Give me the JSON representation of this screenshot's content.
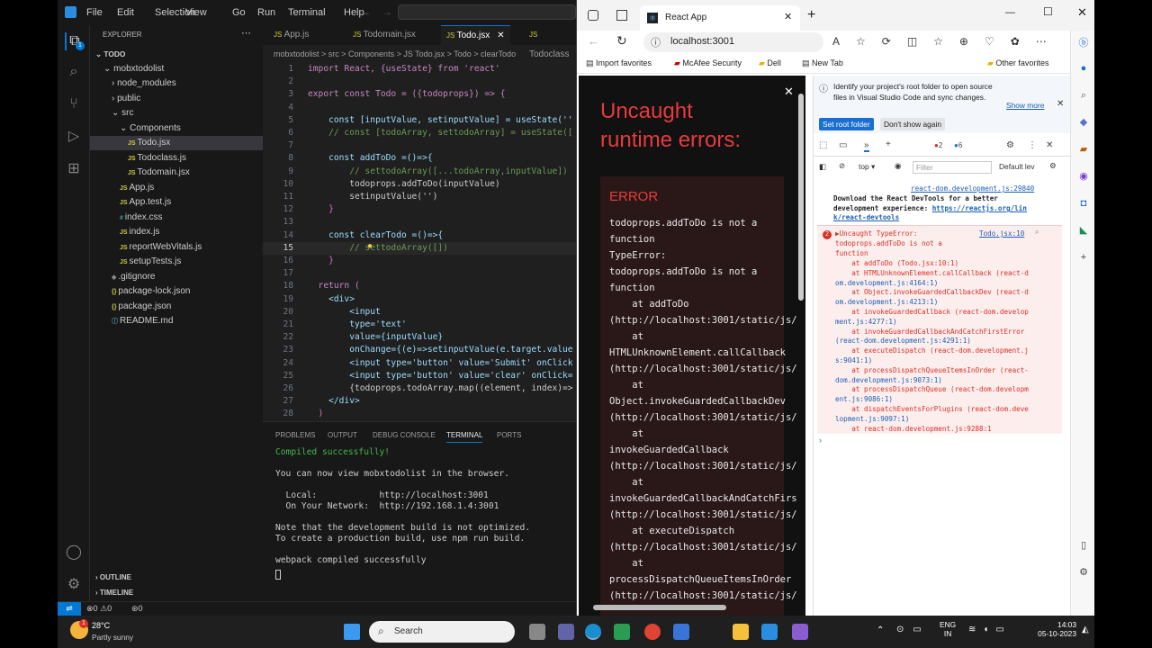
{
  "vscode": {
    "menu": [
      "File",
      "Edit",
      "Selection",
      "View",
      "Go",
      "Run",
      "Terminal",
      "Help"
    ],
    "explorer_title": "EXPLORER",
    "tree": [
      {
        "label": "TODO",
        "indent": 0,
        "type": "root"
      },
      {
        "label": "mobxtodolist",
        "indent": 1,
        "type": "folder"
      },
      {
        "label": "node_modules",
        "indent": 2,
        "type": "folder-closed"
      },
      {
        "label": "public",
        "indent": 2,
        "type": "folder-closed"
      },
      {
        "label": "src",
        "indent": 2,
        "type": "folder"
      },
      {
        "label": "Components",
        "indent": 3,
        "type": "folder"
      },
      {
        "label": "Todo.jsx",
        "indent": 4,
        "type": "js",
        "active": true
      },
      {
        "label": "Todoclass.js",
        "indent": 4,
        "type": "js"
      },
      {
        "label": "Todomain.jsx",
        "indent": 4,
        "type": "js"
      },
      {
        "label": "App.js",
        "indent": 3,
        "type": "js"
      },
      {
        "label": "App.test.js",
        "indent": 3,
        "type": "js"
      },
      {
        "label": "index.css",
        "indent": 3,
        "type": "css"
      },
      {
        "label": "index.js",
        "indent": 3,
        "type": "js"
      },
      {
        "label": "reportWebVitals.js",
        "indent": 3,
        "type": "js"
      },
      {
        "label": "setupTests.js",
        "indent": 3,
        "type": "js"
      },
      {
        "label": ".gitignore",
        "indent": 2,
        "type": "git"
      },
      {
        "label": "package-lock.json",
        "indent": 2,
        "type": "json"
      },
      {
        "label": "package.json",
        "indent": 2,
        "type": "json"
      },
      {
        "label": "README.md",
        "indent": 2,
        "type": "md"
      }
    ],
    "outline": "OUTLINE",
    "timeline": "TIMELINE",
    "tabs": [
      "App.js",
      "Todomain.jsx",
      "Todo.jsx",
      "Todoclass"
    ],
    "breadcrumb": "mobxtodolist > src > Components > JS Todo.jsx > Todo > clearTodo",
    "code": [
      {
        "n": "1",
        "t": "import React, {useState} from 'react'"
      },
      {
        "n": "2",
        "t": ""
      },
      {
        "n": "3",
        "t": "export const Todo = ({todoprops}) => {"
      },
      {
        "n": "4",
        "t": ""
      },
      {
        "n": "5",
        "t": "    const [inputValue, setinputValue] = useState(''"
      },
      {
        "n": "6",
        "t": "    // const [todoArray, settodoArray] = useState(["
      },
      {
        "n": "7",
        "t": ""
      },
      {
        "n": "8",
        "t": "    const addToDo =()=>{"
      },
      {
        "n": "9",
        "t": "        // settodoArray([...todoArray,inputValue])"
      },
      {
        "n": "10",
        "t": "        todoprops.addToDo(inputValue)"
      },
      {
        "n": "11",
        "t": "        setinputValue('')"
      },
      {
        "n": "12",
        "t": "    }"
      },
      {
        "n": "13",
        "t": ""
      },
      {
        "n": "14",
        "t": "    const clearTodo =()=>{"
      },
      {
        "n": "15",
        "t": "        // settodoArray([])"
      },
      {
        "n": "16",
        "t": "    }"
      },
      {
        "n": "17",
        "t": ""
      },
      {
        "n": "18",
        "t": "  return ("
      },
      {
        "n": "19",
        "t": "    <div>"
      },
      {
        "n": "20",
        "t": "        <input"
      },
      {
        "n": "21",
        "t": "        type='text'"
      },
      {
        "n": "22",
        "t": "        value={inputValue}"
      },
      {
        "n": "23",
        "t": "        onChange={(e)=>setinputValue(e.target.value"
      },
      {
        "n": "24",
        "t": "        <input type='button' value='Submit' onClick"
      },
      {
        "n": "25",
        "t": "        <input type='button' value='clear' onClick="
      },
      {
        "n": "26",
        "t": "        {todoprops.todoArray.map((element, index)=>"
      },
      {
        "n": "27",
        "t": "    </div>"
      },
      {
        "n": "28",
        "t": "  )"
      }
    ],
    "panel_tabs": [
      "PROBLEMS",
      "OUTPUT",
      "DEBUG CONSOLE",
      "TERMINAL",
      "PORTS"
    ],
    "terminal": [
      "Compiled successfully!",
      "",
      "You can now view mobxtodolist in the browser.",
      "",
      "  Local:            http://localhost:3001",
      "  On Your Network:  http://192.168.1.4:3001",
      "",
      "Note that the development build is not optimized.",
      "To create a production build, use npm run build.",
      "",
      "webpack compiled successfully"
    ],
    "status": {
      "errors": "0",
      "warnings": "0",
      "ports": "0"
    }
  },
  "browser": {
    "tab_title": "React App",
    "url": "localhost:3001",
    "favorites": [
      "Import favorites",
      "McAfee Security",
      "Dell",
      "New Tab",
      "Other favorites"
    ],
    "overlay": {
      "title_line1": "Uncaught",
      "title_line2": "runtime errors:",
      "error_label": "ERROR",
      "lines": [
        "todoprops.addToDo is not a",
        "function",
        "TypeError:",
        "todoprops.addToDo is not a",
        "function",
        "    at addToDo",
        "(http://localhost:3001/static/js/",
        "    at",
        "HTMLUnknownElement.callCallback",
        "(http://localhost:3001/static/js/",
        "    at",
        "Object.invokeGuardedCallbackDev",
        "(http://localhost:3001/static/js/",
        "    at",
        "invokeGuardedCallback",
        "(http://localhost:3001/static/js/",
        "    at",
        "invokeGuardedCallbackAndCatchFirs",
        "(http://localhost:3001/static/js/",
        "    at executeDispatch",
        "(http://localhost:3001/static/js/",
        "    at",
        "processDispatchQueueItemsInOrder",
        "(http://localhost:3001/static/js/"
      ]
    },
    "devtools": {
      "banner": "Identify your project's root folder to open source files in Visual Studio Code and sync changes.",
      "show_more": "Show more",
      "set_root": "Set root folder",
      "dont_show": "Don't show again",
      "badge_errors": "2",
      "badge_info": "6",
      "context": "top",
      "filter_placeholder": "Filter",
      "levels": "Default lev",
      "log_link": "react-dom.development.js:29840",
      "download_msg_1": "Download the React DevTools for a better",
      "download_msg_2": "development experience: ",
      "download_url": "https://reactjs.org/lin",
      "download_url_2": "k/react-devtools",
      "error_count": "2",
      "error_head": "▶Uncaught TypeError:",
      "error_src": "Todo.jsx:10",
      "error_msg_1": "todoprops.addToDo is not a",
      "error_msg_2": "function",
      "stack": [
        "    at addToDo (Todo.jsx:10:1)",
        "    at HTMLUnknownElement.callCallback (react-d",
        "om.development.js:4164:1)",
        "    at Object.invokeGuardedCallbackDev (react-d",
        "om.development.js:4213:1)",
        "    at invokeGuardedCallback (react-dom.develop",
        "ment.js:4277:1)",
        "    at invokeGuardedCallbackAndCatchFirstError",
        "(react-dom.development.js:4291:1)",
        "    at executeDispatch (react-dom.development.j",
        "s:9041:1)",
        "    at processDispatchQueueItemsInOrder (react-",
        "dom.development.js:9073:1)",
        "    at processDispatchQueue (react-dom.developm",
        "ent.js:9086:1)",
        "    at dispatchEventsForPlugins (react-dom.deve",
        "lopment.js:9097:1)",
        "    at react-dom.development.js:9288:1"
      ]
    }
  },
  "taskbar": {
    "temp": "28°C",
    "weather": "Partly sunny",
    "notif": "1",
    "search": "Search",
    "lang1": "ENG",
    "lang2": "IN",
    "time": "14:03",
    "date": "05-10-2023"
  }
}
